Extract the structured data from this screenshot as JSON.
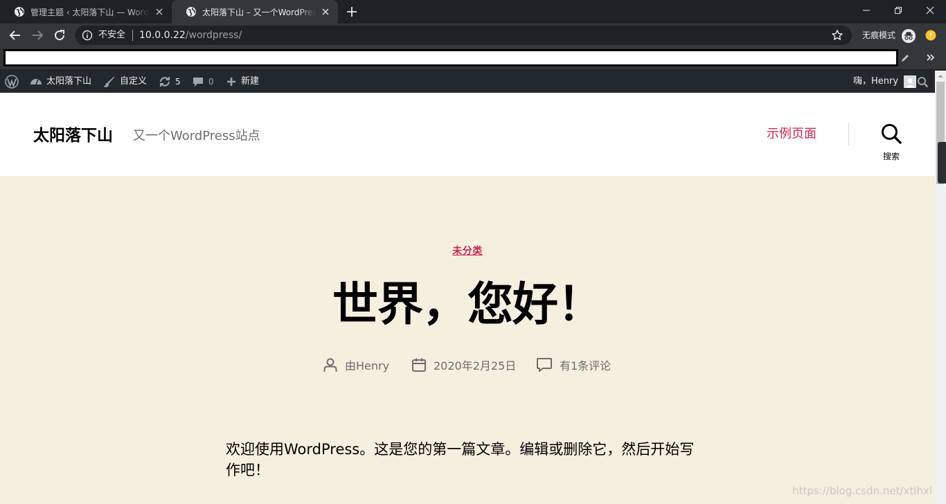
{
  "browser": {
    "tabs": [
      {
        "title": "管理主题 ‹ 太阳落下山 — WordPress",
        "active": false
      },
      {
        "title": "太阳落下山 – 又一个WordPress站点",
        "active": true
      }
    ],
    "new_tab_icon": "plus-icon",
    "window_controls": [
      "minimize-icon",
      "restore-icon",
      "close-icon"
    ],
    "address": {
      "security_label": "不安全",
      "host": "10.0.0.22",
      "path": "/wordpress/"
    },
    "incognito_label": "无痕模式",
    "colors": {
      "frame": "#202124",
      "toolbar": "#35363a",
      "text": "#e8eaed"
    }
  },
  "adminbar": {
    "site_name": "太阳落下山",
    "customize": "自定义",
    "updates_count": "5",
    "comments_count": "0",
    "new": "新建",
    "greeting": "嗨，Henry"
  },
  "header": {
    "site_title": "太阳落下山",
    "site_description": "又一个WordPress站点",
    "menu_item": "示例页面",
    "search_label": "搜索"
  },
  "post": {
    "category": "未分类",
    "title": "世界，您好！",
    "author": "由Henry",
    "date": "2020年2月25日",
    "comments": "有1条评论",
    "content": "欢迎使用WordPress。这是您的第一篇文章。编辑或删除它，然后开始写作吧！"
  },
  "watermark": "https://blog.csdn.net/xtlhxl",
  "colors": {
    "accent": "#cd2653",
    "background": "#f5efe0",
    "adminbar": "#23282d"
  }
}
